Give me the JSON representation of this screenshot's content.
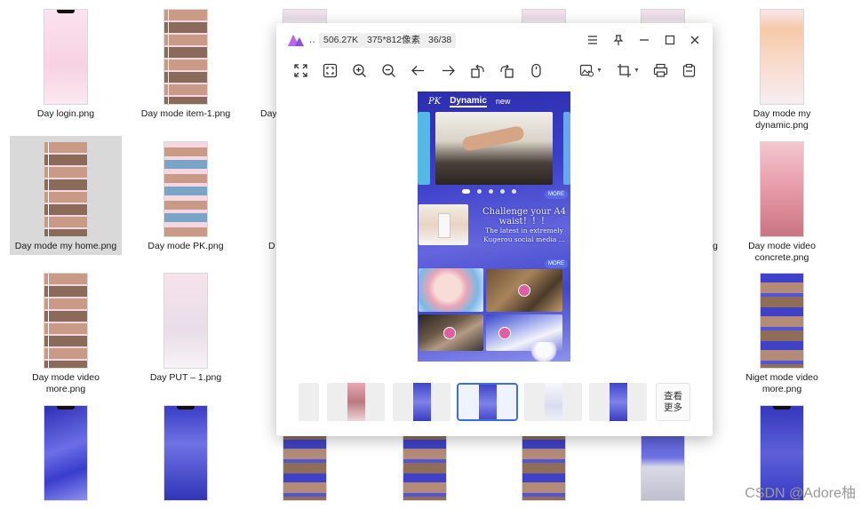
{
  "files": [
    {
      "name": "Day login.png"
    },
    {
      "name": "Day mode item-1.png"
    },
    {
      "name": "Day mode my dynamic.png"
    },
    {
      "name": "Day mode my home.png"
    },
    {
      "name": "Day mode PK.png"
    },
    {
      "name": "Day mode video concrete.png"
    },
    {
      "name": "Day mode video more.png"
    },
    {
      "name": "Day PUT – 1.png"
    },
    {
      "name": "Niget mode video more.png"
    }
  ],
  "partial_labels": {
    "left_1": "Day",
    "left_2": "D",
    "right_2": "g"
  },
  "viewer": {
    "title_dots": "..",
    "file_size": "506.27K",
    "dimensions": "375*812像素",
    "position": "36/38",
    "more_label_1": "查看",
    "more_label_2": "更多"
  },
  "image_content": {
    "tab_pk": "PK",
    "tab_dynamic": "Dynamic",
    "tab_new": "new",
    "more_tag": "MORE",
    "promo_title_1": "Challenge your A4",
    "promo_title_2": "waist！！！",
    "promo_line_1": "The latest in extremely",
    "promo_line_2": "Kugerou social media ..."
  },
  "watermark": "CSDN @Adore柚",
  "colors": {
    "accent": "#3b6fe0",
    "logo": "#8e4fd8"
  }
}
